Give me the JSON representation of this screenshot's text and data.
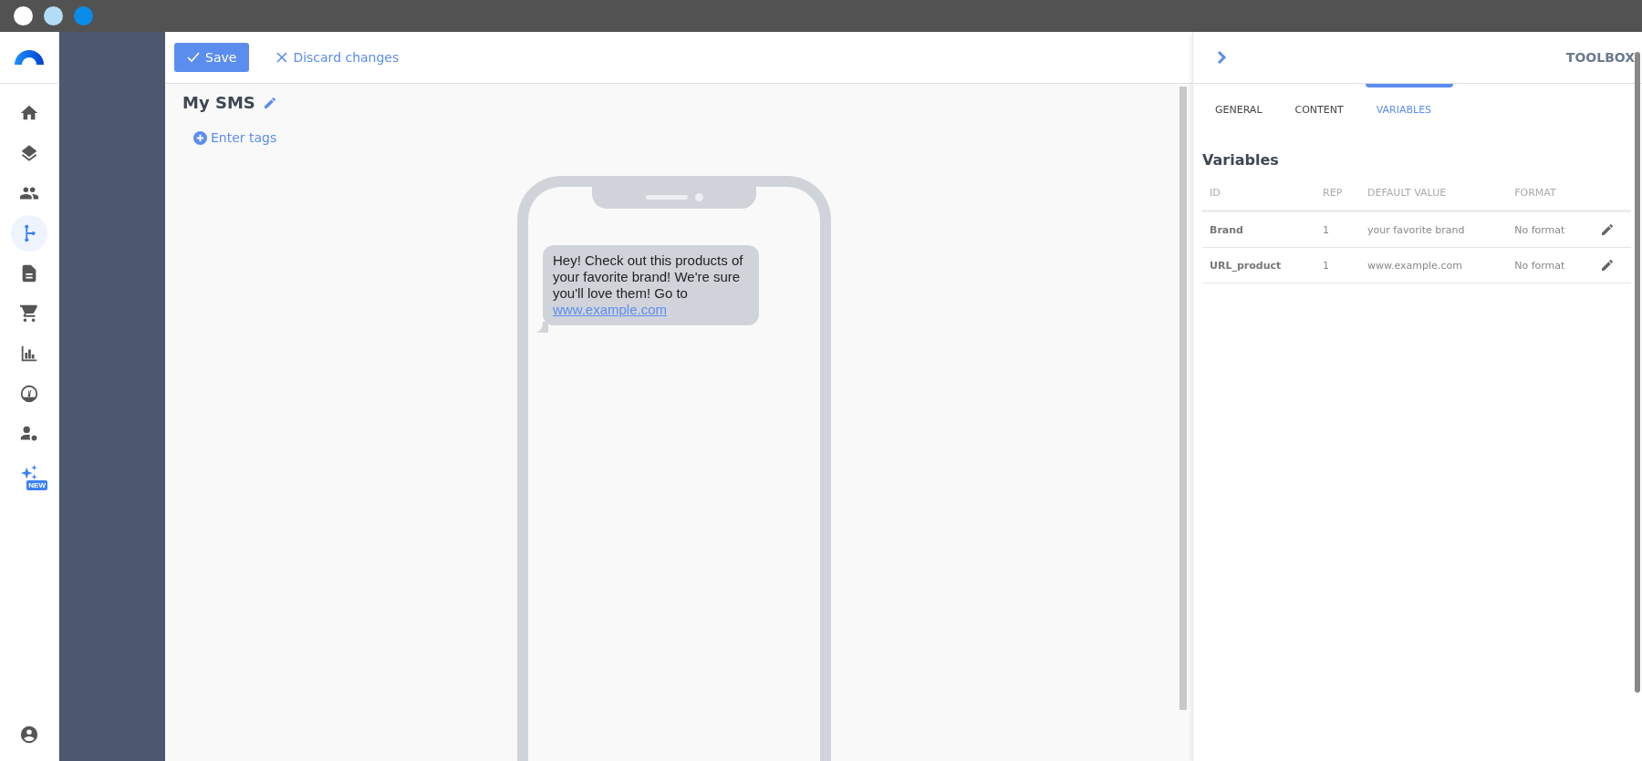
{
  "nav": [
    {
      "kind": "home",
      "selected": false
    },
    {
      "kind": "layers",
      "selected": false
    },
    {
      "kind": "people",
      "selected": false
    },
    {
      "kind": "flow",
      "selected": true
    },
    {
      "kind": "document",
      "selected": false
    },
    {
      "kind": "cart",
      "selected": false
    },
    {
      "kind": "chart",
      "selected": false
    },
    {
      "kind": "gauge",
      "selected": false
    },
    {
      "kind": "user-settings",
      "selected": false
    },
    {
      "kind": "sparkles",
      "selected": false,
      "badge": "NEW"
    }
  ],
  "toolbar": {
    "save": "Save",
    "discard": "Discard changes"
  },
  "editor": {
    "title": "My SMS",
    "tags": "Enter tags",
    "message": "Hey! Check out this products of your favorite brand! We're sure you'll love them! Go to ",
    "link": "www.example.com"
  },
  "toolbox": {
    "title": "TOOLBOX",
    "tabs": [
      {
        "label": "GENERAL",
        "selected": false
      },
      {
        "label": "CONTENT",
        "selected": false
      },
      {
        "label": "VARIABLES",
        "selected": true
      }
    ],
    "heading": "Variables",
    "columns": [
      "ID",
      "REP",
      "DEFAULT VALUE",
      "FORMAT"
    ],
    "rows": [
      {
        "id": "Brand",
        "rep": "1",
        "default_value": "your favorite brand",
        "format": "No format"
      },
      {
        "id": "URL_product",
        "rep": "1",
        "default_value": "www.example.com",
        "format": "No format"
      }
    ]
  }
}
